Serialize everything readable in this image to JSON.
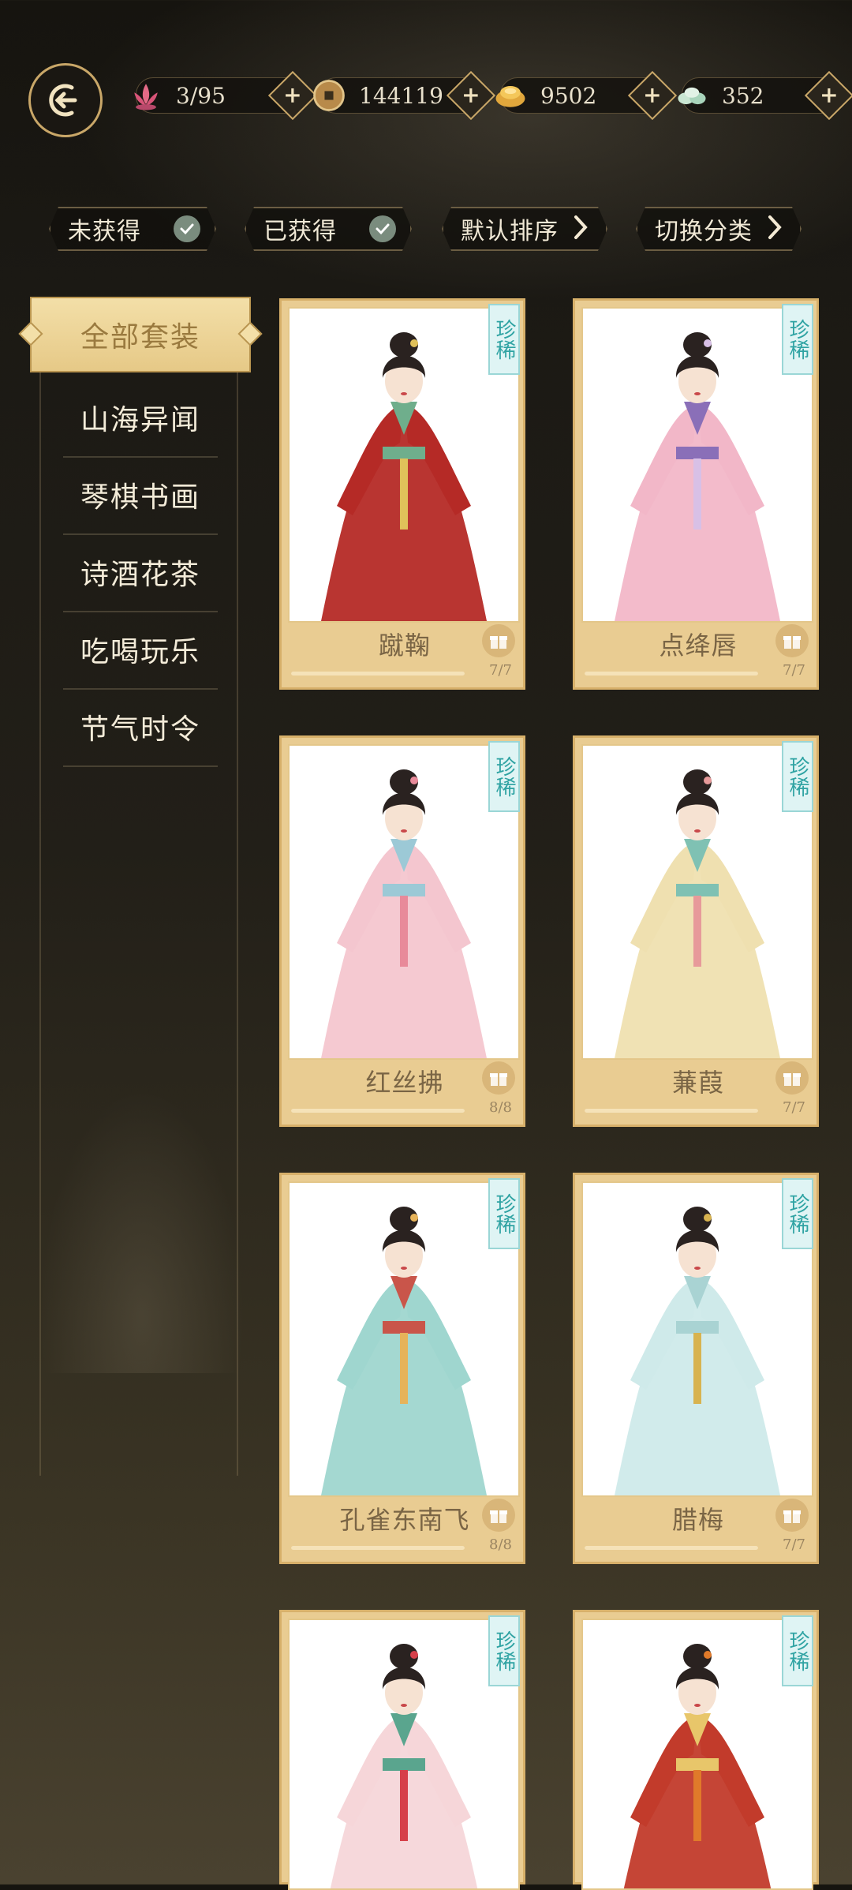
{
  "header": {
    "resources": [
      {
        "icon": "lotus-icon",
        "value": "3/95"
      },
      {
        "icon": "copper-coin-icon",
        "value": "144119"
      },
      {
        "icon": "gold-ingot-icon",
        "value": "9502"
      },
      {
        "icon": "jade-stones-icon",
        "value": "352"
      }
    ]
  },
  "filters": [
    {
      "label": "未获得",
      "control": "check"
    },
    {
      "label": "已获得",
      "control": "check"
    },
    {
      "label": "默认排序",
      "control": "chevron"
    },
    {
      "label": "切换分类",
      "control": "chevron"
    }
  ],
  "sidebar": {
    "active": "全部套装",
    "items": [
      "山海异闻",
      "琴棋书画",
      "诗酒花茶",
      "吃喝玩乐",
      "节气时令"
    ]
  },
  "cards": [
    {
      "name": "蹴鞠",
      "tag": "珍稀",
      "progress": "7/7",
      "ratio": 1.0,
      "palette": {
        "robe": "#b52a26",
        "trim": "#6fae8c",
        "accent": "#e0c15a"
      }
    },
    {
      "name": "点绛唇",
      "tag": "珍稀",
      "progress": "7/7",
      "ratio": 1.0,
      "palette": {
        "robe": "#f2b7c8",
        "trim": "#8a6fb8",
        "accent": "#d8c0e6"
      }
    },
    {
      "name": "红丝拂",
      "tag": "珍稀",
      "progress": "8/8",
      "ratio": 1.0,
      "palette": {
        "robe": "#f4c6cf",
        "trim": "#9cc9d6",
        "accent": "#e88a9a"
      }
    },
    {
      "name": "蒹葭",
      "tag": "珍稀",
      "progress": "7/7",
      "ratio": 1.0,
      "palette": {
        "robe": "#efe0b0",
        "trim": "#7fc1b3",
        "accent": "#e79a9a"
      }
    },
    {
      "name": "孔雀东南飞",
      "tag": "珍稀",
      "progress": "8/8",
      "ratio": 1.0,
      "palette": {
        "robe": "#9fd6cf",
        "trim": "#c9554a",
        "accent": "#e6b35a"
      }
    },
    {
      "name": "腊梅",
      "tag": "珍稀",
      "progress": "7/7",
      "ratio": 1.0,
      "palette": {
        "robe": "#cfeaea",
        "trim": "#a9d3d3",
        "accent": "#d8b34f"
      }
    },
    {
      "name": "",
      "tag": "珍稀",
      "progress": "",
      "ratio": 1.0,
      "palette": {
        "robe": "#f6d6d9",
        "trim": "#5aa58e",
        "accent": "#d6404a"
      }
    },
    {
      "name": "",
      "tag": "珍稀",
      "progress": "",
      "ratio": 1.0,
      "palette": {
        "robe": "#c23b2b",
        "trim": "#e8c66a",
        "accent": "#e07a2a"
      }
    }
  ]
}
